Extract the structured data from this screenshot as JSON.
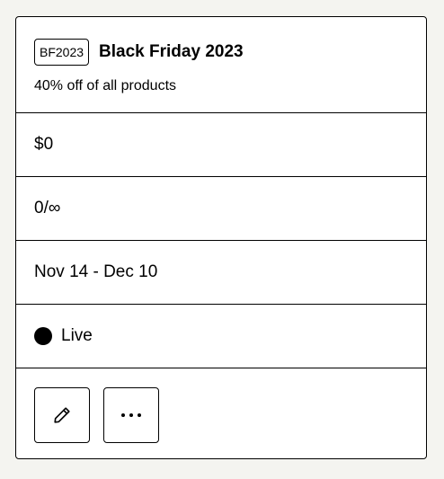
{
  "discount": {
    "code": "BF2023",
    "name": "Black Friday 2023",
    "description": "40% off of all products",
    "revenue": "$0",
    "uses": "0/∞",
    "date_range": "Nov 14 - Dec 10",
    "status": "Live"
  },
  "actions": {
    "edit_icon": "pencil-icon",
    "more_icon": "ellipsis-icon"
  },
  "colors": {
    "page_background": "#f4f4f0",
    "card_background": "#ffffff",
    "border": "#000000",
    "status_dot": "#000000"
  }
}
